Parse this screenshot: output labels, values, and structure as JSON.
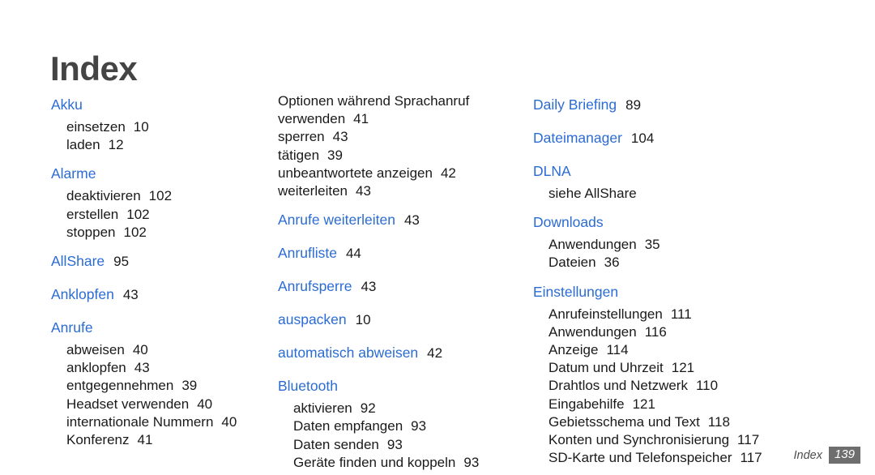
{
  "title": "Index",
  "footer": {
    "label": "Index",
    "page_number": "139"
  },
  "colors": {
    "heading_blue": "#2b6cd4",
    "title_gray": "#444444",
    "body_black": "#1a1a1a",
    "footer_badge_gray": "#6e6e6e"
  },
  "columns": [
    {
      "id": "column-1",
      "groups": [
        {
          "heading": "Akku",
          "heading_page": "",
          "continuation": false,
          "entries": [
            {
              "term": "einsetzen",
              "page": "10"
            },
            {
              "term": "laden",
              "page": "12"
            }
          ]
        },
        {
          "heading": "Alarme",
          "heading_page": "",
          "continuation": false,
          "entries": [
            {
              "term": "deaktivieren",
              "page": "102"
            },
            {
              "term": "erstellen",
              "page": "102"
            },
            {
              "term": "stoppen",
              "page": "102"
            }
          ]
        },
        {
          "heading": "AllShare",
          "heading_page": "95",
          "continuation": false,
          "entries": []
        },
        {
          "heading": "Anklopfen",
          "heading_page": "43",
          "continuation": false,
          "entries": []
        },
        {
          "heading": "Anrufe",
          "heading_page": "",
          "continuation": false,
          "entries": [
            {
              "term": "abweisen",
              "page": "40"
            },
            {
              "term": "anklopfen",
              "page": "43"
            },
            {
              "term": "entgegennehmen",
              "page": "39"
            },
            {
              "term": "Headset verwenden",
              "page": "40"
            },
            {
              "term": "internationale Nummern",
              "page": "40"
            },
            {
              "term": "Konferenz",
              "page": "41"
            }
          ]
        }
      ]
    },
    {
      "id": "column-2",
      "groups": [
        {
          "heading": "",
          "heading_page": "",
          "continuation": true,
          "entries": [
            {
              "term": "Optionen während Sprachanruf",
              "page": ""
            },
            {
              "term": "verwenden",
              "page": "41"
            },
            {
              "term": "sperren",
              "page": "43"
            },
            {
              "term": "tätigen",
              "page": "39"
            },
            {
              "term": "unbeantwortete anzeigen",
              "page": "42"
            },
            {
              "term": "weiterleiten",
              "page": "43"
            }
          ]
        },
        {
          "heading": "Anrufe weiterleiten",
          "heading_page": "43",
          "continuation": false,
          "entries": []
        },
        {
          "heading": "Anrufliste",
          "heading_page": "44",
          "continuation": false,
          "entries": []
        },
        {
          "heading": "Anrufsperre",
          "heading_page": "43",
          "continuation": false,
          "entries": []
        },
        {
          "heading": "auspacken",
          "heading_page": "10",
          "continuation": false,
          "entries": []
        },
        {
          "heading": "automatisch abweisen",
          "heading_page": "42",
          "continuation": false,
          "entries": []
        },
        {
          "heading": "Bluetooth",
          "heading_page": "",
          "continuation": false,
          "entries": [
            {
              "term": "aktivieren",
              "page": "92"
            },
            {
              "term": "Daten empfangen",
              "page": "93"
            },
            {
              "term": "Daten senden",
              "page": "93"
            },
            {
              "term": "Geräte finden und koppeln",
              "page": "93"
            }
          ]
        }
      ]
    },
    {
      "id": "column-3",
      "groups": [
        {
          "heading": "Daily Briefing",
          "heading_page": "89",
          "continuation": false,
          "entries": []
        },
        {
          "heading": "Dateimanager",
          "heading_page": "104",
          "continuation": false,
          "entries": []
        },
        {
          "heading": "DLNA",
          "heading_page": "",
          "continuation": false,
          "entries": [
            {
              "term": "siehe AllShare",
              "page": ""
            }
          ]
        },
        {
          "heading": "Downloads",
          "heading_page": "",
          "continuation": false,
          "entries": [
            {
              "term": "Anwendungen",
              "page": "35"
            },
            {
              "term": "Dateien",
              "page": "36"
            }
          ]
        },
        {
          "heading": "Einstellungen",
          "heading_page": "",
          "continuation": false,
          "entries": [
            {
              "term": "Anrufeinstellungen",
              "page": "111"
            },
            {
              "term": "Anwendungen",
              "page": "116"
            },
            {
              "term": "Anzeige",
              "page": "114"
            },
            {
              "term": "Datum und Uhrzeit",
              "page": "121"
            },
            {
              "term": "Drahtlos und Netzwerk",
              "page": "110"
            },
            {
              "term": "Eingabehilfe",
              "page": "121"
            },
            {
              "term": "Gebietsschema und Text",
              "page": "118"
            },
            {
              "term": "Konten und Synchronisierung",
              "page": "117"
            },
            {
              "term": "SD-Karte und Telefonspeicher",
              "page": "117"
            }
          ]
        }
      ]
    }
  ]
}
